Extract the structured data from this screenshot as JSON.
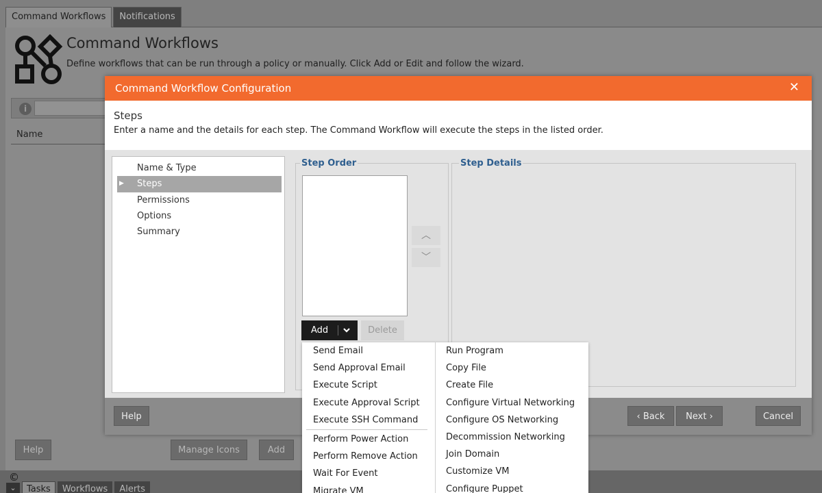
{
  "background": {
    "tabs": [
      {
        "label": "Command Workflows",
        "active": true
      },
      {
        "label": "Notifications",
        "active": false
      }
    ],
    "page_title": "Command Workflows",
    "page_description": "Define workflows that can be run through a policy or manually. Click Add or Edit and follow the wizard.",
    "column_name": "Name",
    "help_label": "Help",
    "manage_icons_label": "Manage Icons",
    "add_label": "Add",
    "bottom_tabs": [
      {
        "label": "Tasks",
        "active": true
      },
      {
        "label": "Workflows",
        "active": false
      },
      {
        "label": "Alerts",
        "active": false
      }
    ],
    "copyright": "©"
  },
  "modal": {
    "title": "Command Workflow Configuration",
    "close": "✕",
    "intro_heading": "Steps",
    "intro_text": "Enter a name and the details for each step. The Command Workflow will execute the steps in the listed order.",
    "nav_items": [
      {
        "label": "Name & Type",
        "active": false
      },
      {
        "label": "Steps",
        "active": true
      },
      {
        "label": "Permissions",
        "active": false
      },
      {
        "label": "Options",
        "active": false
      },
      {
        "label": "Summary",
        "active": false
      }
    ],
    "step_order_legend": "Step Order",
    "step_details_legend": "Step Details",
    "add_label": "Add",
    "delete_label": "Delete",
    "help_label": "Help",
    "back_label": "Back",
    "next_label": "Next",
    "cancel_label": "Cancel"
  },
  "add_menu": {
    "column1_group1": [
      "Send Email",
      "Send Approval Email",
      "Execute Script",
      "Execute Approval Script",
      "Execute SSH Command"
    ],
    "column1_group2": [
      "Perform Power Action",
      "Perform Remove Action",
      "Wait For Event",
      "Migrate VM"
    ],
    "column2": [
      "Run Program",
      "Copy File",
      "Create File",
      "Configure Virtual Networking",
      "Configure OS Networking",
      "Decommission Networking",
      "Join Domain",
      "Customize VM",
      "Configure Puppet"
    ]
  },
  "colors": {
    "header": "#f26a2e",
    "legend": "#2f5f8f",
    "add_button": "#1c1c1c"
  }
}
